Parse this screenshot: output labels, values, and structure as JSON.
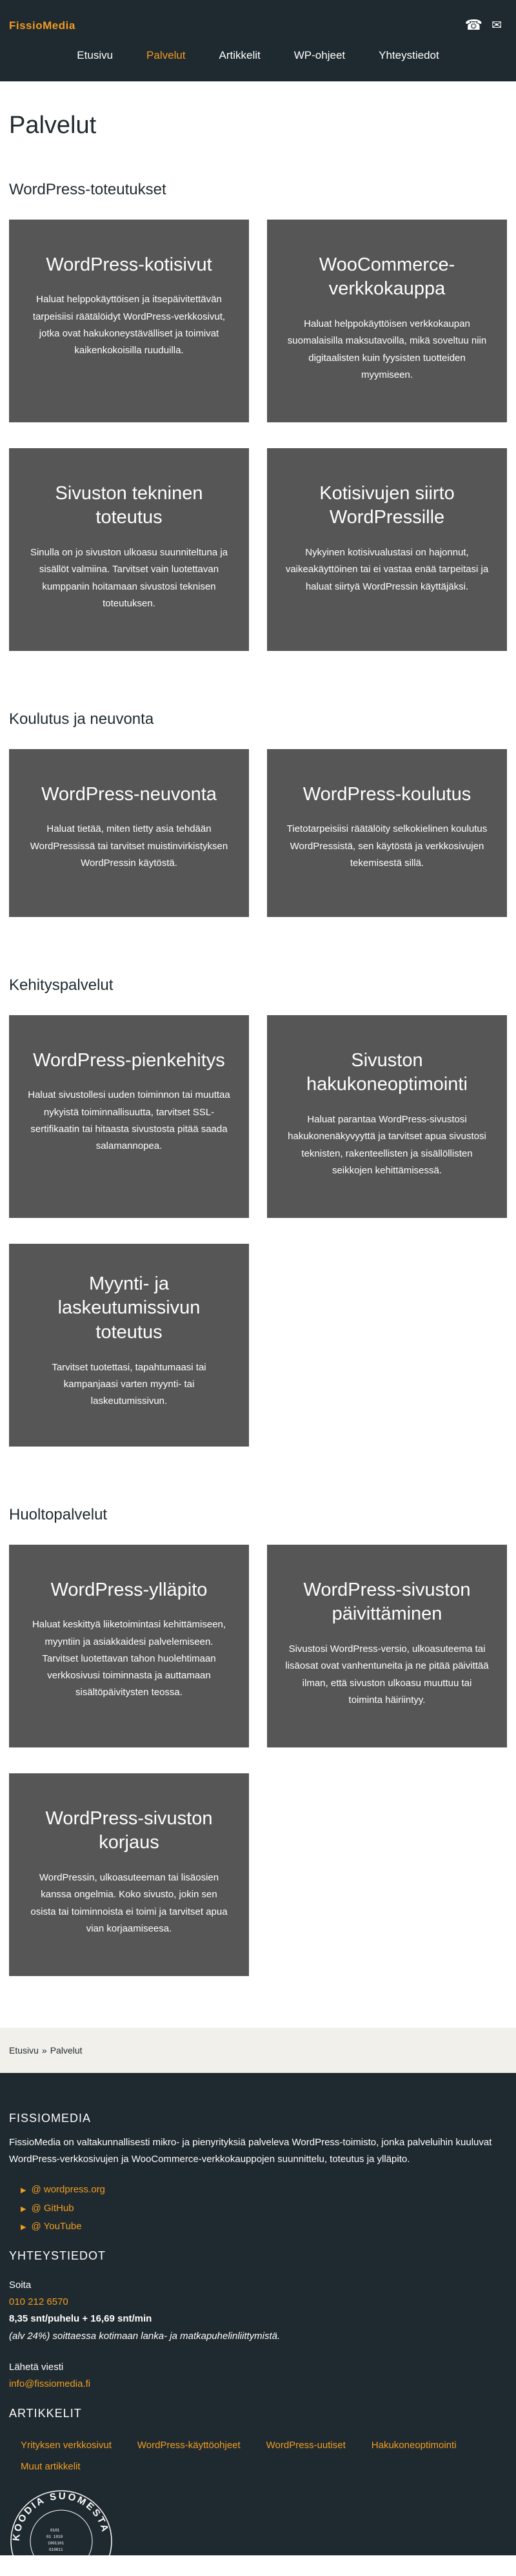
{
  "header": {
    "logo": "FissioMedia",
    "phone_icon": "phone-icon",
    "mail_icon": "mail-icon",
    "nav": [
      {
        "label": "Etusivu",
        "active": false
      },
      {
        "label": "Palvelut",
        "active": true
      },
      {
        "label": "Artikkelit",
        "active": false
      },
      {
        "label": "WP-ohjeet",
        "active": false
      },
      {
        "label": "Yhteystiedot",
        "active": false
      }
    ]
  },
  "page_title": "Palvelut",
  "sections": [
    {
      "title": "WordPress-toteutukset",
      "cards": [
        {
          "title": "WordPress-kotisivut",
          "text": "Haluat helppokäyttöisen ja itsepäivitettävän tarpeisiisi räätälöidyt WordPress-verkkosivut, jotka ovat hakukoneystävälliset ja toimivat kaikenkokoisilla ruuduilla."
        },
        {
          "title": "WooCommerce-verkkokauppa",
          "text": "Haluat helppokäyttöisen verkkokaupan suomalaisilla maksutavoilla, mikä soveltuu niin digitaalisten kuin fyysisten tuotteiden myymiseen."
        },
        {
          "title": "Sivuston tekninen toteutus",
          "text": "Sinulla on jo sivuston ulkoasu suunniteltuna ja sisällöt valmiina. Tarvitset vain luotettavan kumppanin hoitamaan sivustosi teknisen toteutuksen."
        },
        {
          "title": "Kotisivujen siirto WordPressille",
          "text": "Nykyinen kotisivualustasi on hajonnut, vaikeakäyttöinen tai ei vastaa enää tarpeitasi ja haluat siirtyä WordPressin käyttäjäksi."
        }
      ]
    },
    {
      "title": "Koulutus ja neuvonta",
      "cards": [
        {
          "title": "WordPress-neuvonta",
          "text": "Haluat tietää, miten tietty asia tehdään WordPressissä tai tarvitset muistinvirkistyksen WordPressin käytöstä."
        },
        {
          "title": "WordPress-koulutus",
          "text": "Tietotarpeisiisi räätälöity selkokielinen koulutus WordPressistä, sen käytöstä ja verkkosivujen tekemisestä sillä."
        }
      ]
    },
    {
      "title": "Kehityspalvelut",
      "cards": [
        {
          "title": "WordPress-pienkehitys",
          "text": "Haluat sivustollesi uuden toiminnon tai muuttaa nykyistä toiminnallisuutta, tarvitset SSL-sertifikaatin tai hitaasta sivustosta pitää saada salamannopea."
        },
        {
          "title": "Sivuston hakukoneoptimointi",
          "text": "Haluat parantaa WordPress-sivustosi hakukonenäkyvyyttä ja tarvitset apua sivustosi teknisten, rakenteellisten ja sisällöllisten seikkojen kehittämisessä."
        },
        {
          "title": "Myynti- ja laskeutumissivun toteutus",
          "text": "Tarvitset tuotettasi, tapahtumaasi tai kampanjaasi varten myynti- tai laskeutumissivun."
        }
      ]
    },
    {
      "title": "Huoltopalvelut",
      "cards": [
        {
          "title": "WordPress-ylläpito",
          "text": "Haluat keskittyä liiketoimintasi kehittämiseen, myyntiin ja asiakkaidesi palvelemiseen. Tarvitset luotettavan tahon huolehtimaan verkkosivusi toiminnasta ja auttamaan sisältöpäivitysten teossa."
        },
        {
          "title": "WordPress-sivuston päivittäminen",
          "text": "Sivustosi WordPress-versio, ulkoasuteema tai lisäosat ovat vanhentuneita ja ne pitää päivittää ilman, että sivuston ulkoasu muuttuu tai toiminta häiriintyy."
        },
        {
          "title": "WordPress-sivuston korjaus",
          "text": "WordPressin, ulkoasuteeman tai lisäosien kanssa ongelmia. Koko sivusto, jokin sen osista tai toiminnoista ei toimi ja tarvitset apua vian korjaamiseesa."
        }
      ]
    }
  ],
  "breadcrumb": {
    "home": "Etusivu",
    "separator": "»",
    "current": "Palvelut"
  },
  "footer": {
    "about_title": "FISSIOMEDIA",
    "about_text": "FissioMedia on valtakunnallisesti mikro- ja pienyrityksiä palveleva WordPress-toimisto, jonka palveluihin kuuluvat WordPress-verkkosivujen ja WooCommerce-verkkokauppojen suunnittelu, toteutus ja ylläpito.",
    "external_links": [
      "@ wordpress.org",
      "@ GitHub",
      "@ YouTube"
    ],
    "contact_title": "YHTEYSTIEDOT",
    "call_label": "Soita",
    "phone": "010 212 6570",
    "price": "8,35 snt/puhelu + 16,69 snt/min",
    "price_note": "(alv 24%) soittaessa kotimaan lanka- ja matkapuhelinliittymistä.",
    "mail_label": "Lähetä viesti",
    "email": "info@fissiomedia.fi",
    "articles_title": "ARTIKKELIT",
    "article_links": [
      "Yrityksen verkkosivut",
      "WordPress-käyttöohjeet",
      "WordPress-uutiset",
      "Hakukoneoptimointi",
      "Muut artikkelit"
    ],
    "seal_text": "KOODIA SUOMESTA"
  },
  "colors": {
    "header_bg": "#1f2a30",
    "accent": "#f29c1f",
    "card_bg": "#565656",
    "breadcrumb_bg": "#f2f0ea"
  }
}
